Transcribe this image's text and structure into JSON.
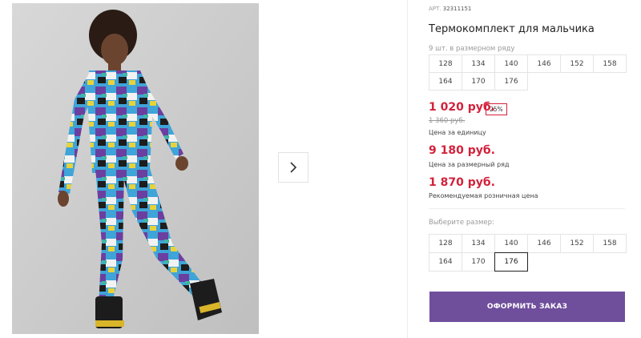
{
  "product": {
    "art_label": "АРТ.",
    "art_number": "32311151",
    "title": "Термокомплект для мальчика",
    "size_row_note": "9 шт. в размерном ряду",
    "size_row": [
      "128",
      "134",
      "140",
      "146",
      "152",
      "158",
      "164",
      "170",
      "176"
    ]
  },
  "pricing": {
    "unit_price": "1 020 руб.",
    "discount": "25%",
    "old_price": "1 360 руб.",
    "unit_caption": "Цена за единицу",
    "row_price": "9 180 руб.",
    "row_caption": "Цена за размерный ряд",
    "retail_price": "1 870 руб.",
    "retail_caption": "Рекомендуемая розничная цена"
  },
  "size_picker": {
    "label": "Выберите размер:",
    "options": [
      "128",
      "134",
      "140",
      "146",
      "152",
      "158",
      "164",
      "170",
      "176"
    ],
    "selected": "176"
  },
  "actions": {
    "order_button": "ОФОРМИТЬ ЗАКАЗ"
  },
  "icons": {
    "next": "chevron-right-icon"
  },
  "colors": {
    "accent_purple": "#6f4e9c",
    "price_red": "#d3223c"
  }
}
